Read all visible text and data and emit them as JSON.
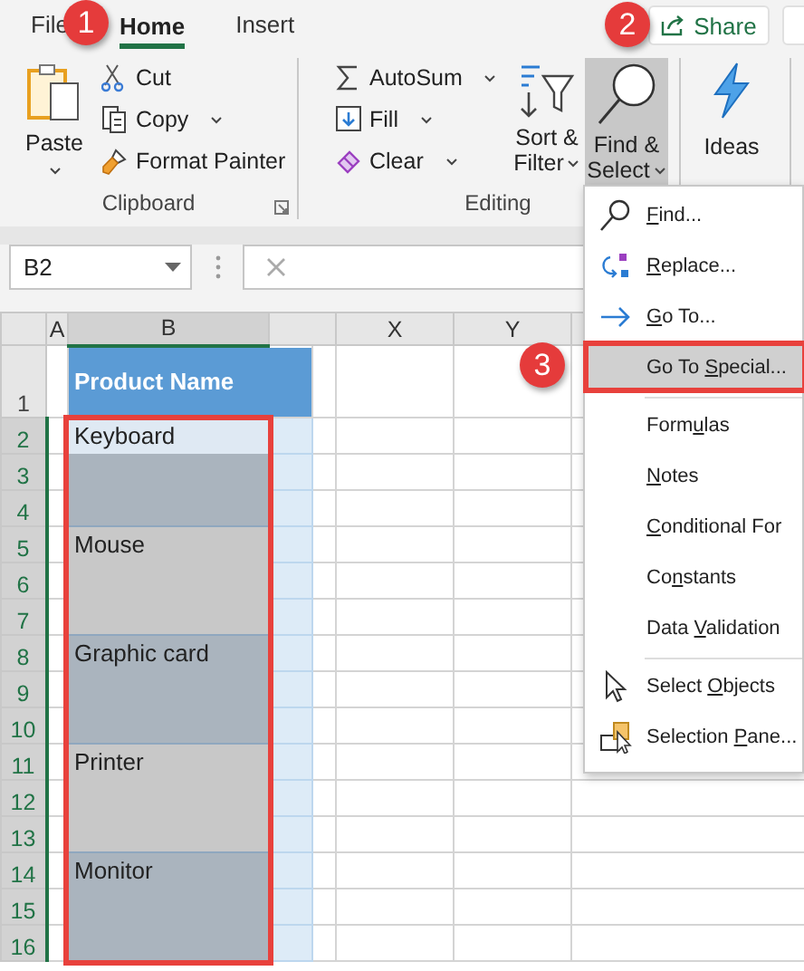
{
  "tabs": [
    {
      "label": "File",
      "selected": false
    },
    {
      "label": "Home",
      "selected": true
    },
    {
      "label": "Insert",
      "selected": false
    }
  ],
  "share_button": {
    "label": "Share"
  },
  "clipboard": {
    "label": "Clipboard",
    "paste": {
      "label": "Paste"
    },
    "commands": [
      {
        "label": "Cut",
        "dropdown": false
      },
      {
        "label": "Copy",
        "dropdown": true
      },
      {
        "label": "Format Painter",
        "dropdown": false
      }
    ]
  },
  "editing": {
    "label": "Editing",
    "commands": [
      {
        "label": "AutoSum",
        "dropdown": true
      },
      {
        "label": "Fill",
        "dropdown": true
      },
      {
        "label": "Clear",
        "dropdown": true
      }
    ],
    "big": [
      {
        "line1": "Sort &",
        "line2": "Filter",
        "pressed": false
      },
      {
        "line1": "Find &",
        "line2": "Select",
        "pressed": true
      }
    ]
  },
  "ideas": {
    "label": "Ideas"
  },
  "name_box": {
    "value": "B2"
  },
  "columns": [
    {
      "label": "A",
      "selected": false
    },
    {
      "label": "B",
      "selected": true
    },
    {
      "selected": false
    },
    {
      "label": "X",
      "selected": false
    },
    {
      "label": "Y",
      "selected": false
    },
    {
      "selected": false
    }
  ],
  "rows": [
    {
      "label": "1",
      "selected": false
    },
    {
      "label": "2",
      "selected": true
    },
    {
      "label": "3",
      "selected": true
    },
    {
      "label": "4",
      "selected": true
    },
    {
      "label": "5",
      "selected": true
    },
    {
      "label": "6",
      "selected": true
    },
    {
      "label": "7",
      "selected": true
    },
    {
      "label": "8",
      "selected": true
    },
    {
      "label": "9",
      "selected": true
    },
    {
      "label": "10",
      "selected": true
    },
    {
      "label": "11",
      "selected": true
    },
    {
      "label": "12",
      "selected": true
    },
    {
      "label": "13",
      "selected": true
    },
    {
      "label": "14",
      "selected": true
    },
    {
      "label": "15",
      "selected": true
    },
    {
      "label": "16",
      "selected": true
    }
  ],
  "header_cell": {
    "text": "Product Name"
  },
  "products": [
    {
      "text": "Keyboard",
      "color": "#aab4be",
      "active": true
    },
    {
      "text": "Mouse",
      "color": "#c8c8c8",
      "active": false
    },
    {
      "text": "Graphic card",
      "color": "#aab4be",
      "active": false
    },
    {
      "text": "Printer",
      "color": "#c8c8c8",
      "active": false
    },
    {
      "text": "Monitor",
      "color": "#aab4be",
      "active": false
    }
  ],
  "menu": [
    {
      "kind": "item",
      "parts": [
        {
          "text": "F",
          "underline": true
        },
        {
          "text": "ind...",
          "underline": false
        }
      ],
      "selected": false
    },
    {
      "kind": "item",
      "parts": [
        {
          "text": "R",
          "underline": true
        },
        {
          "text": "eplace...",
          "underline": false
        }
      ],
      "selected": false
    },
    {
      "kind": "item",
      "parts": [
        {
          "text": "G",
          "underline": true
        },
        {
          "text": "o To...",
          "underline": false
        }
      ],
      "selected": false
    },
    {
      "kind": "item",
      "parts": [
        {
          "text": "Go To ",
          "underline": false
        },
        {
          "text": "S",
          "underline": true
        },
        {
          "text": "pecial...",
          "underline": false
        }
      ],
      "selected": true
    },
    {
      "kind": "separator"
    },
    {
      "kind": "item",
      "parts": [
        {
          "text": "Form",
          "underline": false
        },
        {
          "text": "u",
          "underline": true
        },
        {
          "text": "las",
          "underline": false
        }
      ],
      "selected": false
    },
    {
      "kind": "item",
      "parts": [
        {
          "text": "N",
          "underline": true
        },
        {
          "text": "otes",
          "underline": false
        }
      ],
      "selected": false
    },
    {
      "kind": "item",
      "parts": [
        {
          "text": "C",
          "underline": true
        },
        {
          "text": "onditional For",
          "underline": false
        }
      ],
      "selected": false
    },
    {
      "kind": "item",
      "parts": [
        {
          "text": "Co",
          "underline": false
        },
        {
          "text": "n",
          "underline": true
        },
        {
          "text": "stants",
          "underline": false
        }
      ],
      "selected": false
    },
    {
      "kind": "item",
      "parts": [
        {
          "text": "Data ",
          "underline": false
        },
        {
          "text": "V",
          "underline": true
        },
        {
          "text": "alidation",
          "underline": false
        }
      ],
      "selected": false
    },
    {
      "kind": "separator"
    },
    {
      "kind": "item",
      "parts": [
        {
          "text": "Select ",
          "underline": false
        },
        {
          "text": "O",
          "underline": true
        },
        {
          "text": "bjects",
          "underline": false
        }
      ],
      "selected": false
    },
    {
      "kind": "item",
      "parts": [
        {
          "text": "Selection ",
          "underline": false
        },
        {
          "text": "P",
          "underline": true
        },
        {
          "text": "ane...",
          "underline": false
        }
      ],
      "selected": false
    }
  ],
  "callouts": [
    {
      "label": "1"
    },
    {
      "label": "2"
    },
    {
      "label": "3"
    }
  ]
}
